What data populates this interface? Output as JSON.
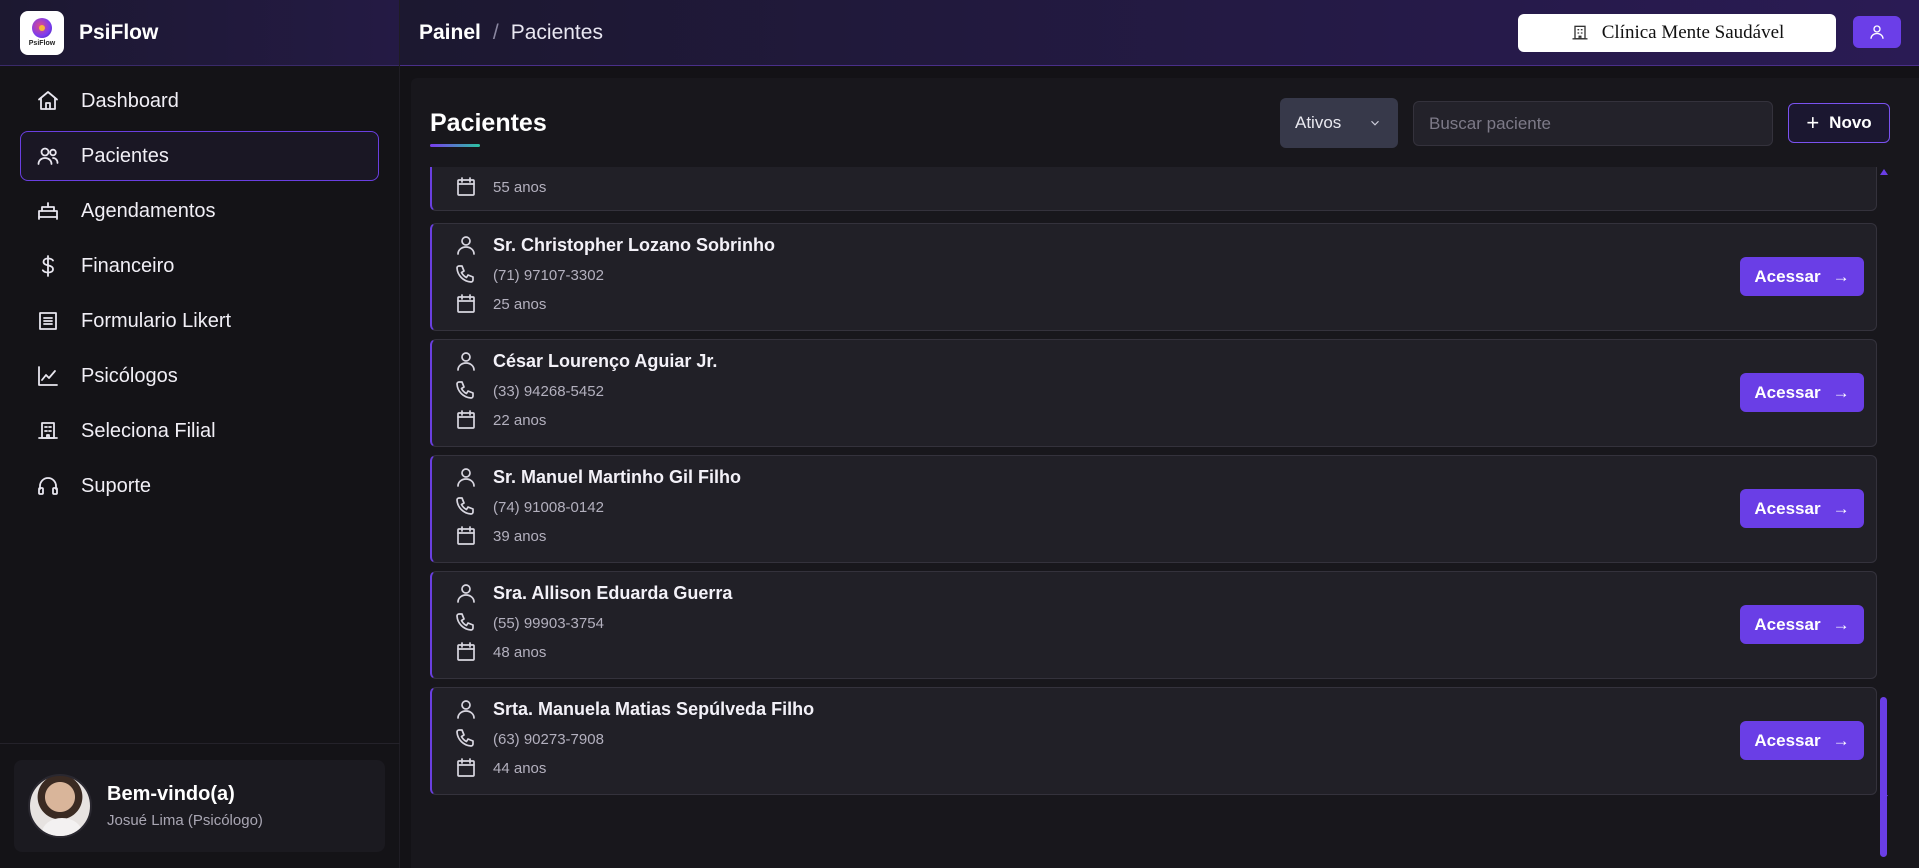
{
  "app": {
    "name": "PsiFlow",
    "logo_text": "PsiFlow"
  },
  "nav": {
    "items": [
      {
        "label": "Dashboard",
        "icon": "home-icon"
      },
      {
        "label": "Pacientes",
        "icon": "users-icon",
        "active": true
      },
      {
        "label": "Agendamentos",
        "icon": "calendar-couch-icon"
      },
      {
        "label": "Financeiro",
        "icon": "dollar-icon"
      },
      {
        "label": "Formulario Likert",
        "icon": "form-list-icon"
      },
      {
        "label": "Psicólogos",
        "icon": "chart-line-icon"
      },
      {
        "label": "Seleciona Filial",
        "icon": "building-icon"
      },
      {
        "label": "Suporte",
        "icon": "headphones-icon"
      }
    ]
  },
  "welcome": {
    "title": "Bem-vindo(a)",
    "subtitle": "Josué Lima (Psicólogo)"
  },
  "header": {
    "breadcrumb_root": "Painel",
    "breadcrumb_sep": "/",
    "breadcrumb_current": "Pacientes",
    "clinic": "Clínica Mente Saudável"
  },
  "main": {
    "title": "Pacientes",
    "filter_value": "Ativos",
    "search_placeholder": "Buscar paciente",
    "new_label": "Novo",
    "access_label": "Acessar",
    "patients": [
      {
        "name": "",
        "phone": "",
        "age": "55 anos"
      },
      {
        "name": "Sr. Christopher Lozano Sobrinho",
        "phone": "(71) 97107-3302",
        "age": "25 anos"
      },
      {
        "name": "César Lourenço Aguiar Jr.",
        "phone": "(33) 94268-5452",
        "age": "22 anos"
      },
      {
        "name": "Sr. Manuel Martinho Gil Filho",
        "phone": "(74) 91008-0142",
        "age": "39 anos"
      },
      {
        "name": "Sra. Allison Eduarda Guerra",
        "phone": "(55) 99903-3754",
        "age": "48 anos"
      },
      {
        "name": "Srta. Manuela Matias Sepúlveda Filho",
        "phone": "(63) 90273-7908",
        "age": "44 anos"
      }
    ]
  },
  "colors": {
    "accent": "#6a3ee6",
    "background": "#131216",
    "card": "#212027"
  }
}
